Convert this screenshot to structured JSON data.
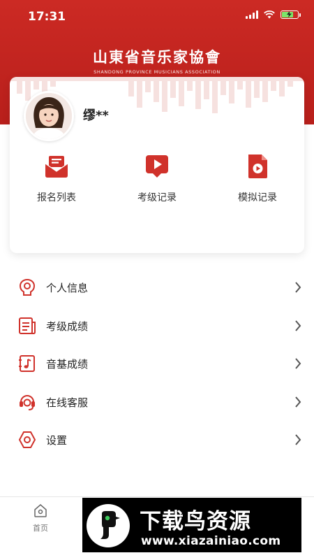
{
  "status_bar": {
    "time": "17:31",
    "battery_level": 0.8
  },
  "header": {
    "logo_text": "山東省音乐家協會",
    "logo_subtitle": "SHANDONG PROVINCE MUSICIANS ASSOCIATION"
  },
  "profile": {
    "username": "缪**"
  },
  "quick_actions": [
    {
      "label": "报名列表",
      "icon": "mail-icon"
    },
    {
      "label": "考级记录",
      "icon": "video-play-icon"
    },
    {
      "label": "模拟记录",
      "icon": "file-play-icon"
    }
  ],
  "menu": [
    {
      "label": "个人信息",
      "icon": "personal-info-icon"
    },
    {
      "label": "考级成绩",
      "icon": "exam-score-icon"
    },
    {
      "label": "音基成绩",
      "icon": "music-theory-score-icon"
    },
    {
      "label": "在线客服",
      "icon": "customer-service-icon"
    },
    {
      "label": "设置",
      "icon": "settings-icon"
    }
  ],
  "tabbar": {
    "home_label": "首页"
  },
  "watermark": {
    "title": "下载鸟资源",
    "url": "www.xiazainiao.com"
  },
  "colors": {
    "brand_red": "#c8261f",
    "icon_red": "#d0322b"
  }
}
